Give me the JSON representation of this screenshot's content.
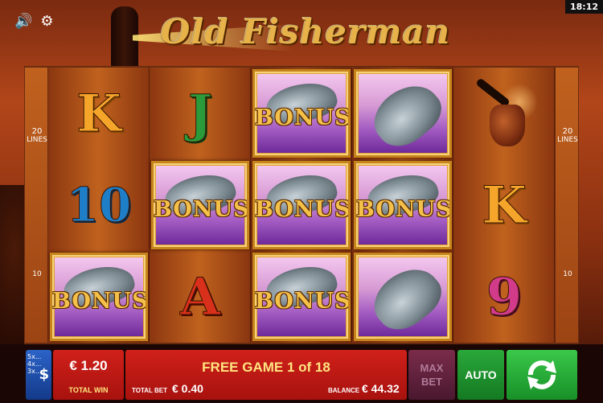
{
  "status_bar": {
    "clock": "18:12"
  },
  "header": {
    "logo_text": "Old Fisherman",
    "sound_icon": "speaker-icon",
    "settings_icon": "gear-icon"
  },
  "side_panels": {
    "left": {
      "lines_top": "20",
      "lines_top_label": "LINES",
      "lines_bottom": "10"
    },
    "right": {
      "lines_top": "20",
      "lines_top_label": "LINES",
      "lines_bottom": "10"
    }
  },
  "reels": [
    [
      "K",
      "10",
      "BONUS"
    ],
    [
      "J",
      "BONUS",
      "A"
    ],
    [
      "BONUS",
      "BONUS",
      "BONUS"
    ],
    [
      "FISH",
      "BONUS",
      "FISH"
    ],
    [
      "PIPE",
      "K",
      "9"
    ]
  ],
  "bonus_label": "BONUS",
  "controls": {
    "denominations": [
      "5x...",
      "4x...",
      "3x..."
    ],
    "currency_symbol": "$",
    "total_win_value": "€ 1.20",
    "total_win_label": "TOTAL WIN",
    "free_game_text": "FREE GAME 1 of 18",
    "total_bet_label": "TOTAL BET",
    "total_bet_value": "€ 0.40",
    "balance_label": "BALANCE",
    "balance_value": "€ 44.32",
    "max_bet_line1": "MAX",
    "max_bet_line2": "BET",
    "auto_label": "AUTO",
    "spin_icon": "spin-arrows-icon"
  },
  "colors": {
    "accent_red": "#d0201a",
    "accent_green": "#2aa83a",
    "gold": "#f3c04a",
    "denom_blue": "#2b63c7"
  }
}
